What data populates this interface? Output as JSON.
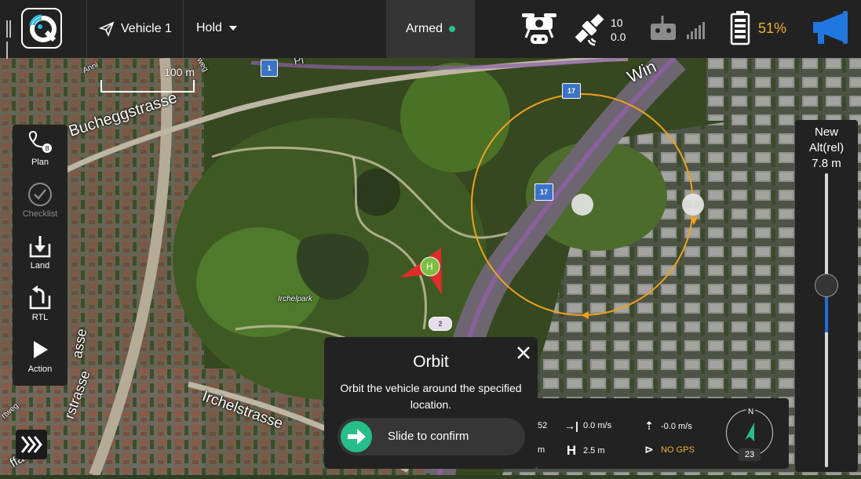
{
  "toolbar": {
    "vehicle_label": "Vehicle 1",
    "flight_mode": "Hold",
    "armed_label": "Armed",
    "gps_satellites": "10",
    "gps_hdop": "0.0",
    "battery_percent": "51%",
    "accent_color": "#27bf89",
    "battery_color": "#f0b429",
    "megaphone_color": "#1e78e0"
  },
  "map": {
    "scale_label": "100 m",
    "street_labels": [
      "Bucheggstrasse",
      "Irchelstrasse",
      "Irchelpark",
      "Win",
      "rstrasse",
      "ffasse",
      "asse",
      "Anni",
      "weg",
      "rtweg",
      "Pi"
    ],
    "route_shields": [
      "1",
      "17",
      "17",
      "2"
    ],
    "home_label": "H"
  },
  "toolstrip": {
    "items": [
      {
        "label": "Plan",
        "icon": "plan-icon"
      },
      {
        "label": "Checklist",
        "icon": "checklist-icon"
      },
      {
        "label": "Land",
        "icon": "land-icon"
      },
      {
        "label": "RTL",
        "icon": "rtl-icon"
      },
      {
        "label": "Action",
        "icon": "action-play-icon"
      }
    ]
  },
  "altitude": {
    "title": "New\nAlt(rel)",
    "value": "7.8 m",
    "level_fraction": 0.62
  },
  "orbit_dialog": {
    "title": "Orbit",
    "description": "Orbit the vehicle around the specified location.",
    "slide_label": "Slide to confirm"
  },
  "telemetry": {
    "partial_left_top": "52",
    "partial_left_bottom": "m",
    "ground_speed": "0.0 m/s",
    "distance_home": "2.5 m",
    "vertical_speed": "-0.0 m/s",
    "gps_status": "NO GPS",
    "gps_status_color": "#f0b429",
    "compass_north": "N",
    "heading": "23"
  }
}
